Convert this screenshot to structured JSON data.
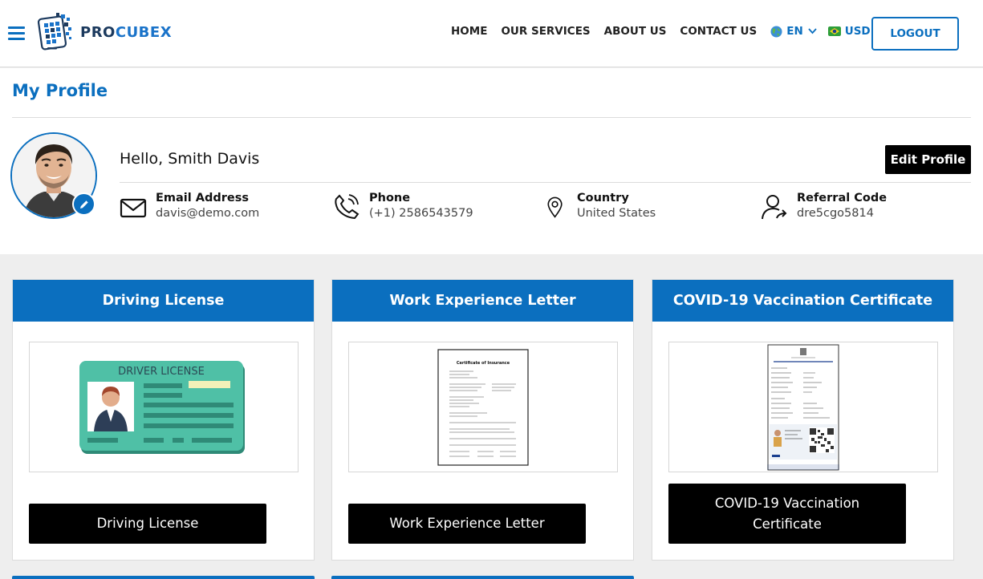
{
  "header": {
    "brand_part1": "PRO",
    "brand_part2": "CUBEX",
    "nav": [
      "HOME",
      "OUR SERVICES",
      "ABOUT US",
      "CONTACT US"
    ],
    "language": "EN",
    "currency": "USD",
    "logout_label": "LOGOUT"
  },
  "profile": {
    "page_title": "My Profile",
    "greeting": "Hello, Smith Davis",
    "edit_label": "Edit Profile",
    "fields": [
      {
        "label": "Email Address",
        "value": "davis@demo.com",
        "icon": "envelope-icon"
      },
      {
        "label": "Phone",
        "value": "(+1) 2586543579",
        "icon": "phone-icon"
      },
      {
        "label": "Country",
        "value": "United States",
        "icon": "location-pin-icon"
      },
      {
        "label": "Referral Code",
        "value": "dre5cgo5814",
        "icon": "user-share-icon"
      }
    ]
  },
  "documents": [
    {
      "title": "Driving License",
      "button": "Driving License",
      "thumb_caption": "DRIVER LICENSE"
    },
    {
      "title": "Work Experience Letter",
      "button": "Work Experience Letter",
      "thumb_caption": "Certificate of Insurance"
    },
    {
      "title": "COVID-19 Vaccination Certificate",
      "button": "COVID-19 Vaccination Certificate"
    }
  ],
  "colors": {
    "primary": "#0b6fbf",
    "dark": "#000000",
    "background": "#eeeeee"
  }
}
